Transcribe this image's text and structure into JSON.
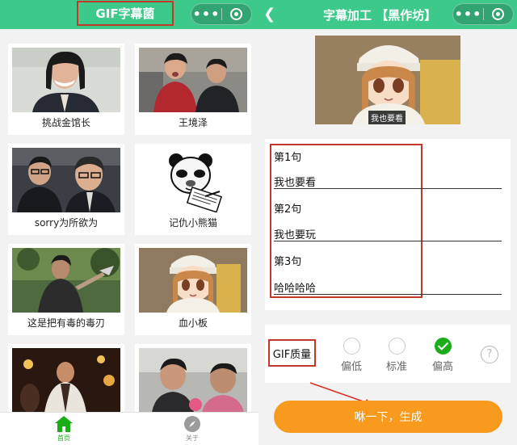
{
  "left_screen": {
    "app_title": "GIF字幕菌",
    "capsule": {
      "more_icon": "more-dots-icon",
      "close_icon": "target-circle-icon"
    },
    "items": [
      {
        "label": "挑战金馆长"
      },
      {
        "label": "王境泽"
      },
      {
        "label": "sorry为所欲为"
      },
      {
        "label": "记仇小熊猫"
      },
      {
        "label": "这是把有毒的毒刃"
      },
      {
        "label": "血小板"
      },
      {
        "label": ""
      },
      {
        "label": ""
      }
    ],
    "tabbar": {
      "home": {
        "label": "首页",
        "icon": "home-icon",
        "active": true
      },
      "about": {
        "label": "关于",
        "icon": "compass-icon",
        "active": false
      }
    }
  },
  "right_screen": {
    "title": "字幕加工 【黑作坊】",
    "back_icon": "chevron-left-icon",
    "preview_caption": "我也要看",
    "lines": [
      {
        "label": "第1句",
        "value": "我也要看"
      },
      {
        "label": "第2句",
        "value": "我也要玩"
      },
      {
        "label": "第3句",
        "value": "哈哈哈哈"
      }
    ],
    "quality": {
      "label": "GIF质量",
      "options": [
        {
          "label": "偏低",
          "selected": false
        },
        {
          "label": "标准",
          "selected": false
        },
        {
          "label": "偏高",
          "selected": true
        }
      ],
      "help": "?"
    },
    "generate_button": "咻一下，生成"
  },
  "colors": {
    "brand_green": "#3dc98a",
    "annotation_red": "#c0392b",
    "button_orange": "#f89a1e",
    "radio_green": "#1aad19"
  }
}
